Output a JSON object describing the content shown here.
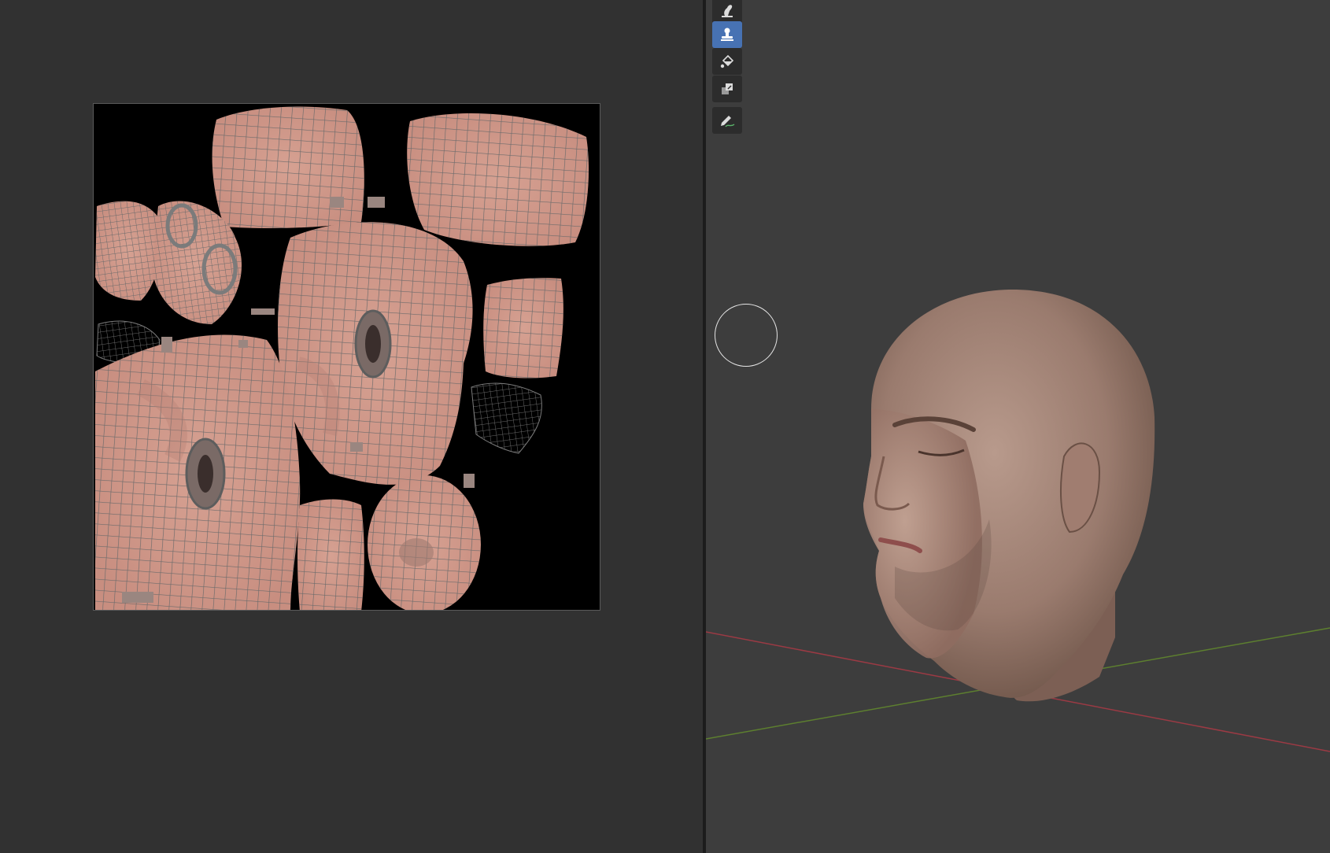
{
  "uv_editor": {
    "background_color": "#313131",
    "image_background_color": "#000000",
    "uv_wire_color": "#5d5d5d",
    "skin_color": "#cf9c8c"
  },
  "viewport_3d": {
    "background_color": "#3d3d3d",
    "x_axis_color": "#9b3a44",
    "y_axis_color": "#5d7f2f",
    "brush_cursor_color": "#e6e6e6"
  },
  "toolbar": {
    "tools": [
      {
        "icon": "smear-icon",
        "active": false
      },
      {
        "icon": "clone-stamp-icon",
        "active": true
      },
      {
        "icon": "fill-bucket-icon",
        "active": false
      },
      {
        "icon": "mask-icon",
        "active": false
      },
      {
        "icon": "annotate-pen-icon",
        "active": false
      }
    ],
    "active_color": "#4772b3"
  }
}
